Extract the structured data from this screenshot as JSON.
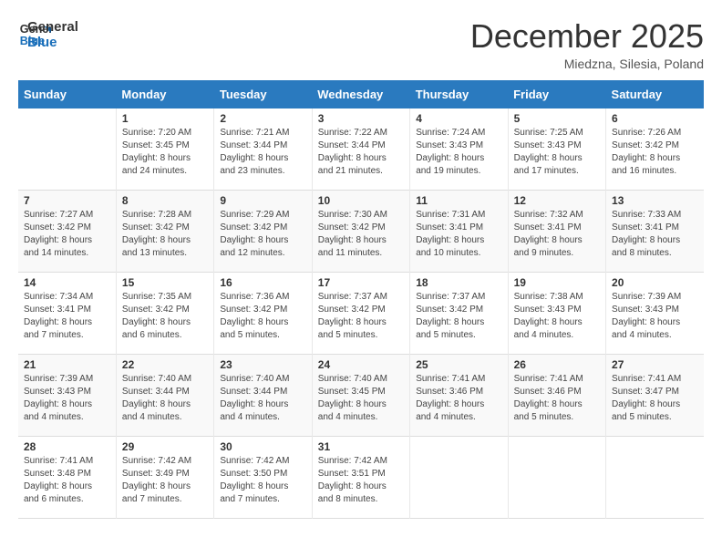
{
  "header": {
    "logo_line1": "General",
    "logo_line2": "Blue",
    "month": "December 2025",
    "location": "Miedzna, Silesia, Poland"
  },
  "days_of_week": [
    "Sunday",
    "Monday",
    "Tuesday",
    "Wednesday",
    "Thursday",
    "Friday",
    "Saturday"
  ],
  "weeks": [
    [
      {
        "day": "",
        "info": ""
      },
      {
        "day": "1",
        "info": "Sunrise: 7:20 AM\nSunset: 3:45 PM\nDaylight: 8 hours\nand 24 minutes."
      },
      {
        "day": "2",
        "info": "Sunrise: 7:21 AM\nSunset: 3:44 PM\nDaylight: 8 hours\nand 23 minutes."
      },
      {
        "day": "3",
        "info": "Sunrise: 7:22 AM\nSunset: 3:44 PM\nDaylight: 8 hours\nand 21 minutes."
      },
      {
        "day": "4",
        "info": "Sunrise: 7:24 AM\nSunset: 3:43 PM\nDaylight: 8 hours\nand 19 minutes."
      },
      {
        "day": "5",
        "info": "Sunrise: 7:25 AM\nSunset: 3:43 PM\nDaylight: 8 hours\nand 17 minutes."
      },
      {
        "day": "6",
        "info": "Sunrise: 7:26 AM\nSunset: 3:42 PM\nDaylight: 8 hours\nand 16 minutes."
      }
    ],
    [
      {
        "day": "7",
        "info": "Sunrise: 7:27 AM\nSunset: 3:42 PM\nDaylight: 8 hours\nand 14 minutes."
      },
      {
        "day": "8",
        "info": "Sunrise: 7:28 AM\nSunset: 3:42 PM\nDaylight: 8 hours\nand 13 minutes."
      },
      {
        "day": "9",
        "info": "Sunrise: 7:29 AM\nSunset: 3:42 PM\nDaylight: 8 hours\nand 12 minutes."
      },
      {
        "day": "10",
        "info": "Sunrise: 7:30 AM\nSunset: 3:42 PM\nDaylight: 8 hours\nand 11 minutes."
      },
      {
        "day": "11",
        "info": "Sunrise: 7:31 AM\nSunset: 3:41 PM\nDaylight: 8 hours\nand 10 minutes."
      },
      {
        "day": "12",
        "info": "Sunrise: 7:32 AM\nSunset: 3:41 PM\nDaylight: 8 hours\nand 9 minutes."
      },
      {
        "day": "13",
        "info": "Sunrise: 7:33 AM\nSunset: 3:41 PM\nDaylight: 8 hours\nand 8 minutes."
      }
    ],
    [
      {
        "day": "14",
        "info": "Sunrise: 7:34 AM\nSunset: 3:41 PM\nDaylight: 8 hours\nand 7 minutes."
      },
      {
        "day": "15",
        "info": "Sunrise: 7:35 AM\nSunset: 3:42 PM\nDaylight: 8 hours\nand 6 minutes."
      },
      {
        "day": "16",
        "info": "Sunrise: 7:36 AM\nSunset: 3:42 PM\nDaylight: 8 hours\nand 5 minutes."
      },
      {
        "day": "17",
        "info": "Sunrise: 7:37 AM\nSunset: 3:42 PM\nDaylight: 8 hours\nand 5 minutes."
      },
      {
        "day": "18",
        "info": "Sunrise: 7:37 AM\nSunset: 3:42 PM\nDaylight: 8 hours\nand 5 minutes."
      },
      {
        "day": "19",
        "info": "Sunrise: 7:38 AM\nSunset: 3:43 PM\nDaylight: 8 hours\nand 4 minutes."
      },
      {
        "day": "20",
        "info": "Sunrise: 7:39 AM\nSunset: 3:43 PM\nDaylight: 8 hours\nand 4 minutes."
      }
    ],
    [
      {
        "day": "21",
        "info": "Sunrise: 7:39 AM\nSunset: 3:43 PM\nDaylight: 8 hours\nand 4 minutes."
      },
      {
        "day": "22",
        "info": "Sunrise: 7:40 AM\nSunset: 3:44 PM\nDaylight: 8 hours\nand 4 minutes."
      },
      {
        "day": "23",
        "info": "Sunrise: 7:40 AM\nSunset: 3:44 PM\nDaylight: 8 hours\nand 4 minutes."
      },
      {
        "day": "24",
        "info": "Sunrise: 7:40 AM\nSunset: 3:45 PM\nDaylight: 8 hours\nand 4 minutes."
      },
      {
        "day": "25",
        "info": "Sunrise: 7:41 AM\nSunset: 3:46 PM\nDaylight: 8 hours\nand 4 minutes."
      },
      {
        "day": "26",
        "info": "Sunrise: 7:41 AM\nSunset: 3:46 PM\nDaylight: 8 hours\nand 5 minutes."
      },
      {
        "day": "27",
        "info": "Sunrise: 7:41 AM\nSunset: 3:47 PM\nDaylight: 8 hours\nand 5 minutes."
      }
    ],
    [
      {
        "day": "28",
        "info": "Sunrise: 7:41 AM\nSunset: 3:48 PM\nDaylight: 8 hours\nand 6 minutes."
      },
      {
        "day": "29",
        "info": "Sunrise: 7:42 AM\nSunset: 3:49 PM\nDaylight: 8 hours\nand 7 minutes."
      },
      {
        "day": "30",
        "info": "Sunrise: 7:42 AM\nSunset: 3:50 PM\nDaylight: 8 hours\nand 7 minutes."
      },
      {
        "day": "31",
        "info": "Sunrise: 7:42 AM\nSunset: 3:51 PM\nDaylight: 8 hours\nand 8 minutes."
      },
      {
        "day": "",
        "info": ""
      },
      {
        "day": "",
        "info": ""
      },
      {
        "day": "",
        "info": ""
      }
    ]
  ]
}
